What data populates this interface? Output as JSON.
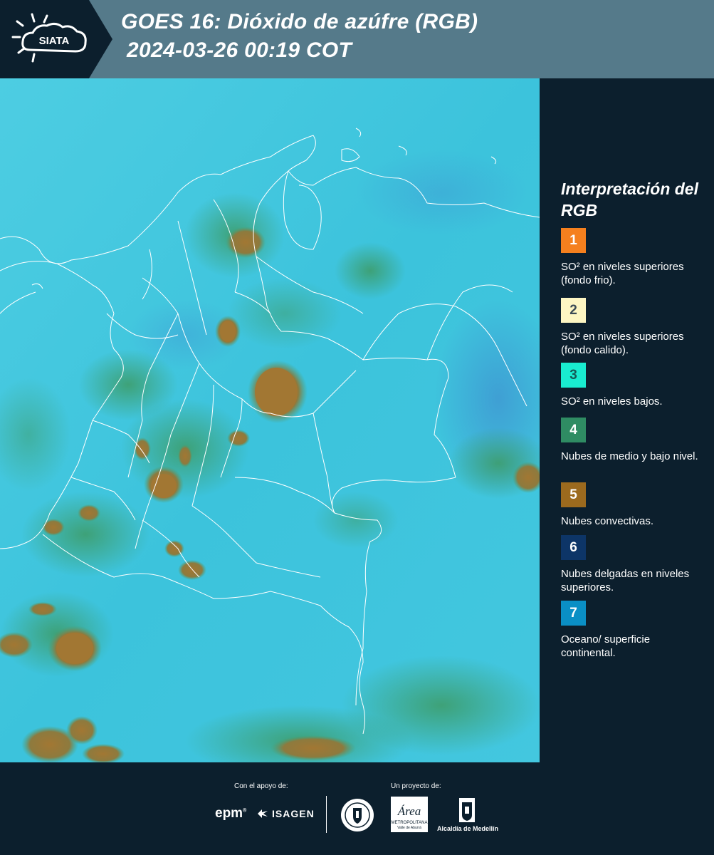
{
  "header": {
    "logo_text": "SIATA",
    "title_line1": "GOES 16: Dióxido de azúfre (RGB)",
    "title_line2": "2024-03-26 00:19 COT"
  },
  "legend": {
    "title": "Interpretación del RGB",
    "items": [
      {
        "number": "1",
        "color": "#f5801e",
        "text": "SO² en niveles superiores (fondo frio)."
      },
      {
        "number": "2",
        "color": "#fdf6c3",
        "text": "SO² en niveles superiores (fondo calido)."
      },
      {
        "number": "3",
        "color": "#19ecd0",
        "text": "SO² en niveles bajos."
      },
      {
        "number": "4",
        "color": "#2f8c63",
        "text": "Nubes de medio y bajo nivel."
      },
      {
        "number": "5",
        "color": "#9c6a1e",
        "text": "Nubes convectivas."
      },
      {
        "number": "6",
        "color": "#0d3567",
        "text": "Nubes delgadas en niveles superiores."
      },
      {
        "number": "7",
        "color": "#0a8fc5",
        "text": "Oceano/ superficie continental."
      }
    ]
  },
  "footer": {
    "support_caption": "Con el apoyo de:",
    "project_caption": "Un proyecto de:",
    "sponsor_epm": "epm",
    "sponsor_isagen": "ISAGEN",
    "area_logo_text": "Área",
    "area_subtext": "METROPOLITANA",
    "area_subtext2": "Valle de Aburrá",
    "alcaldia_text": "Alcaldía de Medellín"
  },
  "colors": {
    "header_bg": "#557a8a",
    "panel_bg": "#0c1f2d",
    "map_base": "#3cc6dd",
    "convective": "#9c7a3a",
    "low_cloud": "#3a9f6a",
    "border_line": "#ffffff"
  }
}
